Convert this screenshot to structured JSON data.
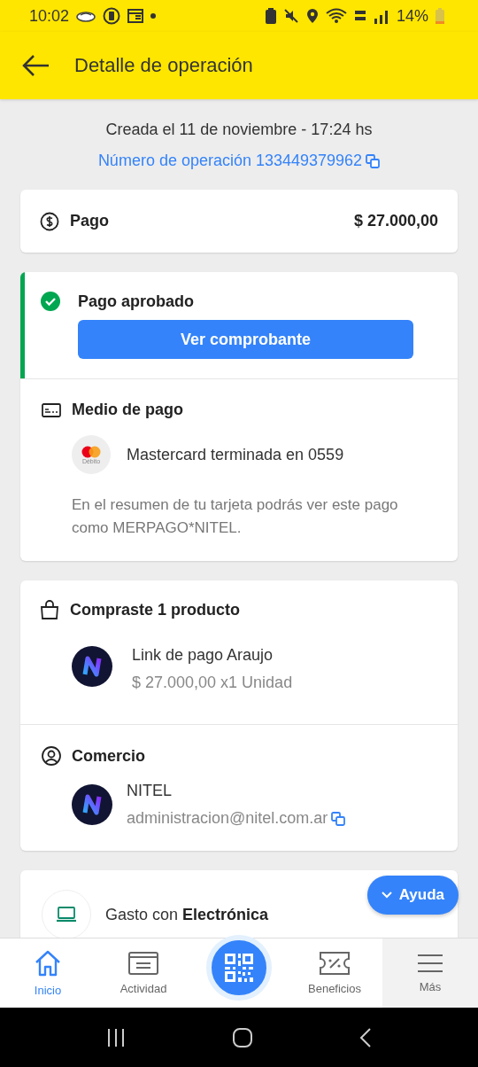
{
  "status_bar": {
    "time": "10:02",
    "battery": "14%"
  },
  "header": {
    "title": "Detalle de operación"
  },
  "created": "Creada el 11 de noviembre - 17:24 hs",
  "operation_number": "Número de operación 133449379962",
  "payment": {
    "label": "Pago",
    "amount": "$ 27.000,00"
  },
  "status": {
    "title": "Pago aprobado",
    "approved": true,
    "button": "Ver comprobante"
  },
  "payment_method": {
    "title": "Medio de pago",
    "card_badge": "Débito",
    "card": "Mastercard terminada en 0559",
    "note": "En el resumen de tu tarjeta podrás ver este pago como MERPAGO*NITEL."
  },
  "products": {
    "title": "Compraste 1 producto",
    "items": [
      {
        "name": "Link de pago Araujo",
        "detail": "$ 27.000,00 x1 Unidad"
      }
    ]
  },
  "merchant": {
    "title": "Comercio",
    "name": "NITEL",
    "email": "administracion@nitel.com.ar"
  },
  "category": {
    "text": "Gasto con **Electrónica**"
  },
  "help_button": "Ayuda",
  "nav": [
    {
      "kind": "home",
      "label": "Inicio",
      "selected": true,
      "highlighted": false
    },
    {
      "kind": "activity",
      "label": "Actividad",
      "selected": false,
      "highlighted": false
    },
    {
      "kind": "qr"
    },
    {
      "kind": "benefits",
      "label": "Beneficios",
      "selected": false,
      "highlighted": false
    },
    {
      "kind": "more",
      "label": "Más",
      "selected": false,
      "highlighted": true
    }
  ]
}
